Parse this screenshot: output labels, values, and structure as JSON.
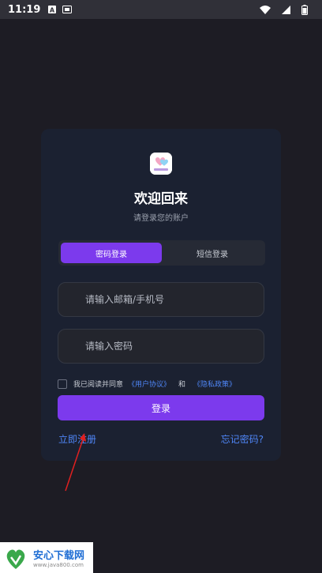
{
  "status_bar": {
    "time": "11:19",
    "icons": [
      "a-notification-icon",
      "screen-notification-icon",
      "wifi-icon",
      "signal-icon",
      "battery-icon"
    ]
  },
  "login": {
    "title": "欢迎回来",
    "subtitle": "请登录您的账户",
    "tabs": [
      {
        "label": "密码登录",
        "active": true
      },
      {
        "label": "短信登录",
        "active": false
      }
    ],
    "account_placeholder": "请输入邮箱/手机号",
    "password_placeholder": "请输入密码",
    "agreement": {
      "prefix": "我已阅读并同意",
      "user_agreement": "《用户协议》",
      "and": "和",
      "privacy_policy": "《隐私政策》"
    },
    "login_button": "登录",
    "register_link": "立即注册",
    "forgot_link": "忘记密码?"
  },
  "watermark": {
    "name": "安心下载网",
    "url": "www.java800.com"
  },
  "colors": {
    "accent": "#7c3aed",
    "link": "#4f86f7",
    "background": "#1d1c24",
    "card": "#1b2131",
    "annotation_arrow": "#e02020"
  }
}
